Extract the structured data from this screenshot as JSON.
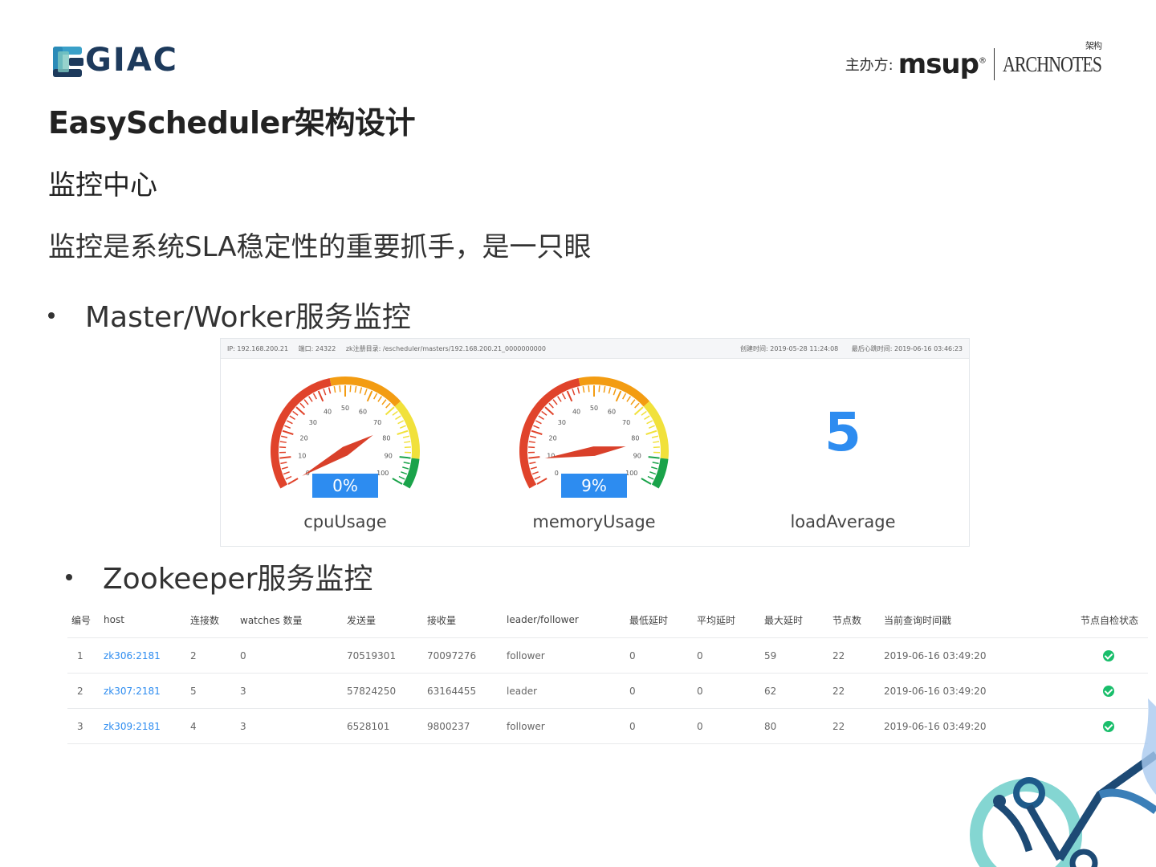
{
  "header": {
    "logo_text": "GIAC",
    "sponsor_label": "主办方:",
    "sponsor_msup": "msup",
    "sponsor_archnotes": "ARCHNOTES",
    "sponsor_archnotes_cn": "架构"
  },
  "slide": {
    "title": "EasyScheduler架构设计",
    "section": "监控中心",
    "subtitle": "监控是系统SLA稳定性的重要抓手，是一只眼",
    "bullet_master": "Master/Worker服务监控",
    "bullet_zk": "Zookeeper服务监控"
  },
  "monitor": {
    "info_left": [
      "IP: 192.168.200.21",
      "端口: 24322",
      "zk注册目录: /escheduler/masters/192.168.200.21_0000000000"
    ],
    "info_right": [
      "创建时间: 2019-05-28 11:24:08",
      "最后心跳时间: 2019-06-16 03:46:23"
    ],
    "gauges": [
      {
        "name": "cpuUsage",
        "value_text": "0%",
        "value": 0
      },
      {
        "name": "memoryUsage",
        "value_text": "9%",
        "value": 9
      }
    ],
    "gauge_ticks": [
      "0",
      "10",
      "20",
      "30",
      "40",
      "50",
      "60",
      "70",
      "80",
      "90",
      "100"
    ],
    "load_average": {
      "name": "loadAverage",
      "value": "5"
    }
  },
  "zk_table": {
    "columns": [
      "编号",
      "host",
      "连接数",
      "watches 数量",
      "发送量",
      "接收量",
      "leader/follower",
      "最低延时",
      "平均延时",
      "最大延时",
      "节点数",
      "当前查询时间戳",
      "节点自检状态"
    ],
    "rows": [
      [
        "1",
        "zk306:2181",
        "2",
        "0",
        "70519301",
        "70097276",
        "follower",
        "0",
        "0",
        "59",
        "22",
        "2019-06-16 03:49:20"
      ],
      [
        "2",
        "zk307:2181",
        "5",
        "3",
        "57824250",
        "63164455",
        "leader",
        "0",
        "0",
        "62",
        "22",
        "2019-06-16 03:49:20"
      ],
      [
        "3",
        "zk309:2181",
        "4",
        "3",
        "6528101",
        "9800237",
        "follower",
        "0",
        "0",
        "80",
        "22",
        "2019-06-16 03:49:20"
      ]
    ],
    "status_icon": "check-circle-icon",
    "status_color": "#19be6b"
  },
  "colors": {
    "accent": "#2d8cf0",
    "gauge_red": "#e0432b",
    "gauge_orange": "#f39c12",
    "gauge_yellow": "#f1e13b",
    "gauge_green": "#1aa34a"
  }
}
